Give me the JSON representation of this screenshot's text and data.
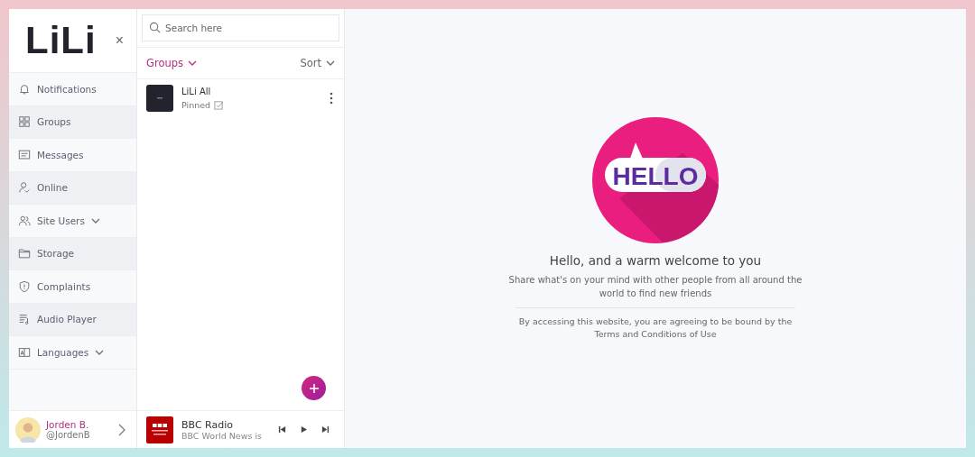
{
  "sidebar": {
    "logo": "LiLi",
    "close": "×",
    "items": [
      {
        "label": "Notifications",
        "expandable": false
      },
      {
        "label": "Groups",
        "expandable": false
      },
      {
        "label": "Messages",
        "expandable": false
      },
      {
        "label": "Online",
        "expandable": false
      },
      {
        "label": "Site Users",
        "expandable": true
      },
      {
        "label": "Storage",
        "expandable": false
      },
      {
        "label": "Complaints",
        "expandable": false
      },
      {
        "label": "Audio Player",
        "expandable": false
      },
      {
        "label": "Languages",
        "expandable": true
      }
    ],
    "user": {
      "name": "Jorden B.",
      "handle": "@JordenB"
    }
  },
  "list_panel": {
    "search": {
      "placeholder": "Search here"
    },
    "filter": "Groups",
    "sort": "Sort",
    "groups": [
      {
        "name": "LiLi All",
        "status": "Pinned",
        "pinned": true
      }
    ]
  },
  "player": {
    "title": "BBC Radio",
    "subtitle": "BBC World News is"
  },
  "welcome": {
    "badge": "HELLO",
    "title": "Hello, and a warm welcome to you",
    "text": "Share what's on your mind with other people from all around the world to find new friends",
    "terms": "By accessing this website, you are agreeing to be bound by the Terms and Conditions of Use"
  }
}
